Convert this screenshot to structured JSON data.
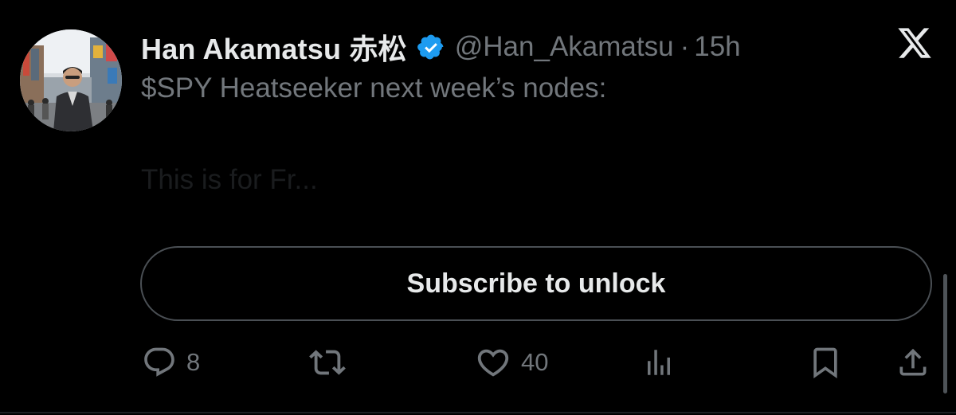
{
  "author": {
    "display_name": "Han Akamatsu 赤松",
    "handle": "@Han_Akamatsu",
    "separator": "·",
    "time": "15h",
    "verified": true,
    "verified_color": "#1d9bf0"
  },
  "tweet": {
    "text": "$SPY Heatseeker next week’s nodes:",
    "faded_preview": "This is for Fr..."
  },
  "subscribe": {
    "label": "Subscribe to unlock"
  },
  "actions": {
    "replies": {
      "icon": "reply-icon",
      "count": "8"
    },
    "reposts": {
      "icon": "repost-icon",
      "count": ""
    },
    "likes": {
      "icon": "heart-icon",
      "count": "40"
    },
    "views": {
      "icon": "views-icon",
      "count": ""
    },
    "bookmark": {
      "icon": "bookmark-icon"
    },
    "share": {
      "icon": "share-icon"
    }
  },
  "colors": {
    "background": "#000000",
    "primary_text": "#e7e9ea",
    "secondary_text": "#71767b",
    "border": "#4a4f54"
  }
}
